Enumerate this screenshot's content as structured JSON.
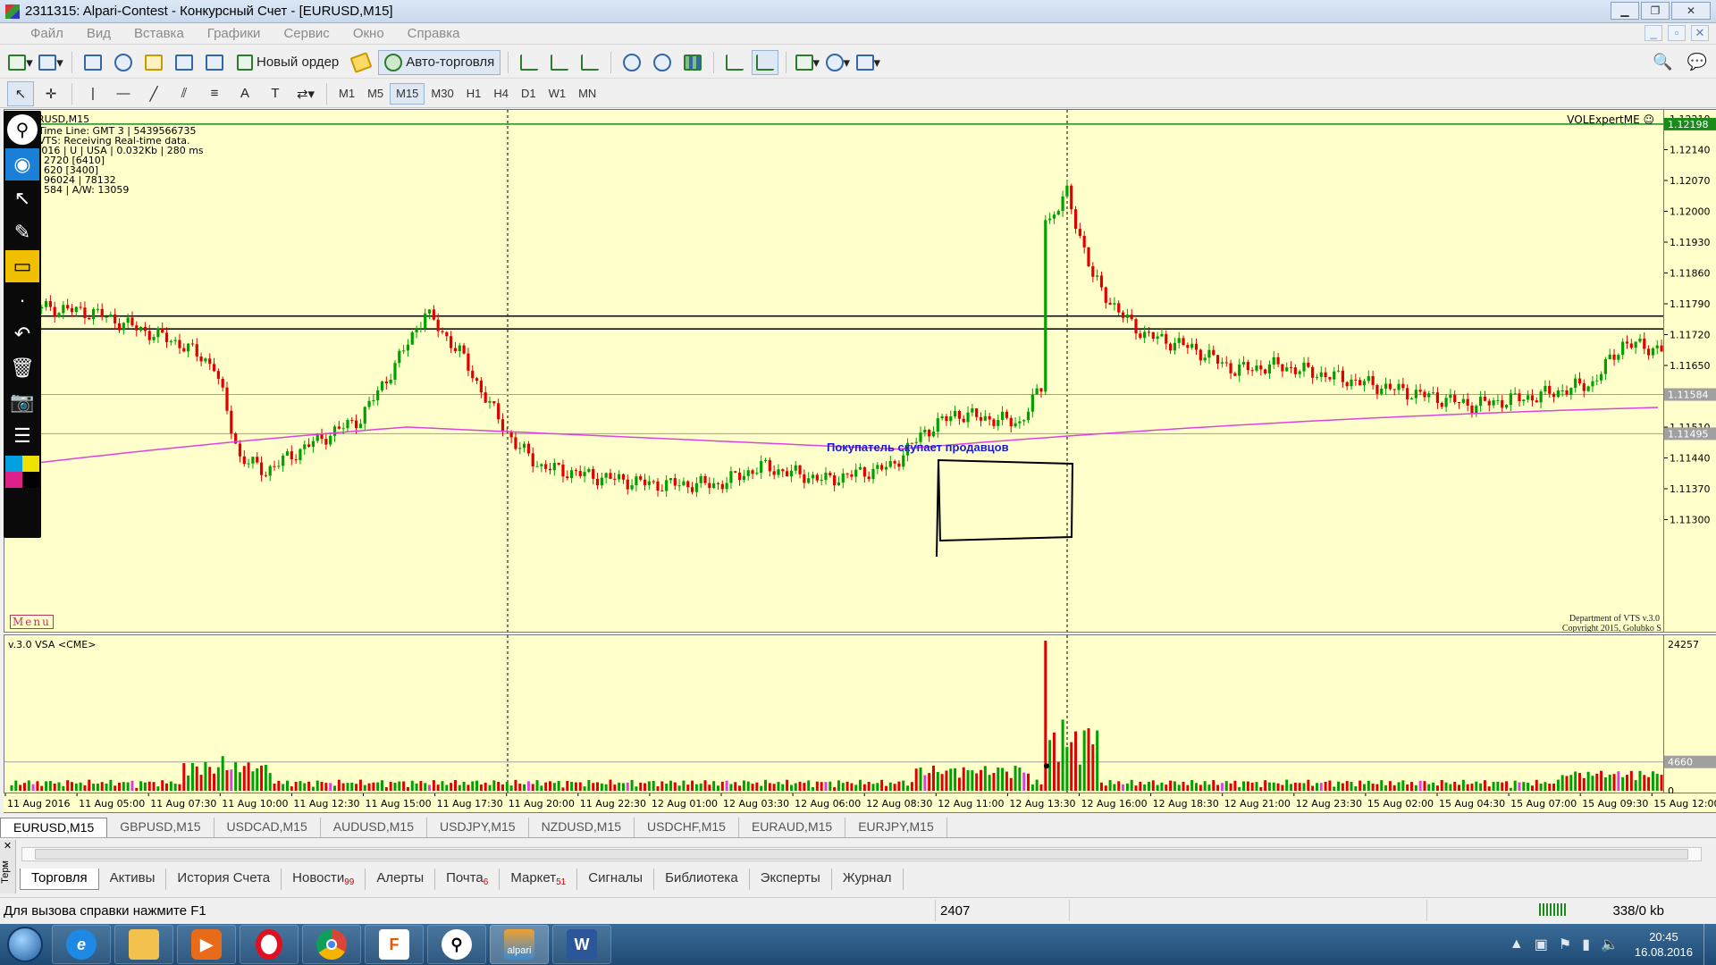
{
  "window": {
    "title": "2311315: Alpari-Contest - Конкурсный Счет - [EURUSD,M15]"
  },
  "menu": [
    "Файл",
    "Вид",
    "Вставка",
    "Графики",
    "Сервис",
    "Окно",
    "Справка"
  ],
  "toolbar": {
    "new_order": "Новый ордер",
    "auto_trading": "Авто-торговля"
  },
  "timeframes": [
    "M1",
    "M5",
    "M15",
    "M30",
    "H1",
    "H4",
    "D1",
    "W1",
    "MN"
  ],
  "active_timeframe": "M15",
  "chart": {
    "symbol_line": "EURUSD,M15",
    "info_lines": [
      "Time Line: GMT 3 | 5439566735",
      "VTS:  Receiving Real-time data.",
      "13/9/2016 | U | USA | 0.032Kb | 280 ms",
      "2720  [6410]",
      "620  [3400]",
      "96024 | 78132",
      "584 | A/W: 13059"
    ],
    "indicator_name": "VOLExpertME",
    "annotation": "Покупатель скупает продавцов",
    "menu_button": "Menu",
    "copyright_1": "Department of VTS  v.3.0",
    "copyright_2": "Copyright 2015, Golubko S",
    "vol_label": "v.3.0 VSA <CME>",
    "price_ticks": [
      "1.12210",
      "1.12140",
      "1.12070",
      "1.12000",
      "1.11930",
      "1.11860",
      "1.11790",
      "1.11720",
      "1.11650",
      "1.11510",
      "1.11440",
      "1.11370",
      "1.11300"
    ],
    "price_badges": [
      "1.12198",
      "1.11584",
      "1.11495"
    ],
    "vol_ticks": [
      "24257",
      "4660",
      "0"
    ],
    "time_labels": [
      "11 Aug 2016",
      "11 Aug 05:00",
      "11 Aug 07:30",
      "11 Aug 10:00",
      "11 Aug 12:30",
      "11 Aug 15:00",
      "11 Aug 17:30",
      "11 Aug 20:00",
      "11 Aug 22:30",
      "12 Aug 01:00",
      "12 Aug 03:30",
      "12 Aug 06:00",
      "12 Aug 08:30",
      "12 Aug 11:00",
      "12 Aug 13:30",
      "12 Aug 16:00",
      "12 Aug 18:30",
      "12 Aug 21:00",
      "12 Aug 23:30",
      "15 Aug 02:00",
      "15 Aug 04:30",
      "15 Aug 07:00",
      "15 Aug 09:30",
      "15 Aug 12:00"
    ],
    "colors": {
      "background": "#ffffcc",
      "bull": "#00a000",
      "bear": "#e00000",
      "ma": "#dd44dd",
      "annotation": "#1a1ad6"
    }
  },
  "symbol_tabs": [
    "EURUSD,M15",
    "GBPUSD,M15",
    "USDCAD,M15",
    "AUDUSD,M15",
    "USDJPY,M15",
    "NZDUSD,M15",
    "USDCHF,M15",
    "EURAUD,M15",
    "EURJPY,M15"
  ],
  "terminal": {
    "side_label": "Терм",
    "tabs": [
      {
        "label": "Торговля",
        "badge": ""
      },
      {
        "label": "Активы",
        "badge": ""
      },
      {
        "label": "История Счета",
        "badge": ""
      },
      {
        "label": "Новости",
        "badge": "99"
      },
      {
        "label": "Алерты",
        "badge": ""
      },
      {
        "label": "Почта",
        "badge": "6"
      },
      {
        "label": "Маркет",
        "badge": "51"
      },
      {
        "label": "Сигналы",
        "badge": ""
      },
      {
        "label": "Библиотека",
        "badge": ""
      },
      {
        "label": "Эксперты",
        "badge": ""
      },
      {
        "label": "Журнал",
        "badge": ""
      }
    ]
  },
  "status": {
    "help": "Для вызова справки нажмите F1",
    "value": "2407",
    "traffic": "338/0 kb"
  },
  "taskbar": {
    "apps": [
      "ie-icon",
      "explorer-icon",
      "media-player-icon",
      "opera-icon",
      "chrome-icon",
      "app-f-icon",
      "keyhole-icon",
      "alpari-icon",
      "word-icon"
    ],
    "alpari_label": "alpari",
    "time": "20:45",
    "date": "16.08.2016"
  }
}
